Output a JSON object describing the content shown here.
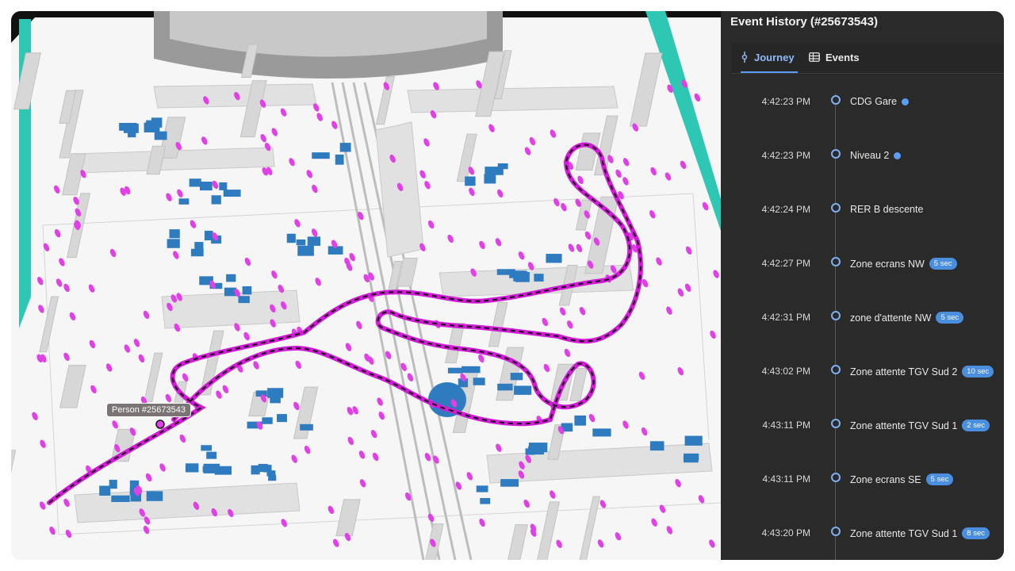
{
  "panel": {
    "title": "Event History (#25673543)",
    "tabs": [
      {
        "label": "Journey",
        "icon": "route-icon",
        "active": true
      },
      {
        "label": "Events",
        "icon": "table-icon",
        "active": false
      }
    ]
  },
  "events": [
    {
      "time": "4:42:23 PM",
      "label": "CDG Gare",
      "dot": true,
      "badge": ""
    },
    {
      "time": "4:42:23 PM",
      "label": "Niveau 2",
      "dot": true,
      "badge": ""
    },
    {
      "time": "4:42:24 PM",
      "label": "RER B descente",
      "dot": false,
      "badge": ""
    },
    {
      "time": "4:42:27 PM",
      "label": "Zone ecrans NW",
      "dot": false,
      "badge": "5 sec"
    },
    {
      "time": "4:42:31 PM",
      "label": "zone d'attente NW",
      "dot": false,
      "badge": "5 sec"
    },
    {
      "time": "4:43:02 PM",
      "label": "Zone attente TGV Sud 2",
      "dot": false,
      "badge": "10 sec"
    },
    {
      "time": "4:43:11 PM",
      "label": "Zone attente TGV Sud 1",
      "dot": false,
      "badge": "2 sec"
    },
    {
      "time": "4:43:11 PM",
      "label": "Zone ecrans SE",
      "dot": false,
      "badge": "5 sec"
    },
    {
      "time": "4:43:20 PM",
      "label": "Zone attente TGV Sud 1",
      "dot": false,
      "badge": "8 sec"
    }
  ],
  "scene": {
    "person_label": "Person #25673543"
  },
  "colors": {
    "accent": "#5b9cf5",
    "trail": "#d21bd6",
    "person_marker": "#e040e6",
    "seating": "#2f7bbf",
    "wall_accent": "#2ec7b4",
    "panel_bg": "#2b2a2a"
  }
}
